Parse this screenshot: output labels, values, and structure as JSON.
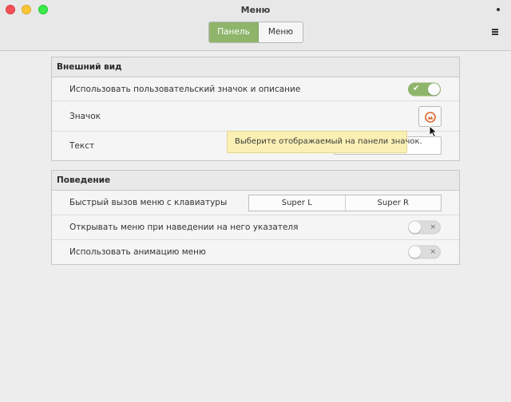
{
  "window": {
    "title": "Меню"
  },
  "switcher": {
    "panel_label": "Панель",
    "menu_label": "Меню",
    "active": "Панель"
  },
  "appearance": {
    "header": "Внешний вид",
    "custom_icon": {
      "label": "Использовать пользовательский значок и описание",
      "state": "on"
    },
    "icon": {
      "label": "Значок"
    },
    "text": {
      "label": "Текст",
      "value": ""
    }
  },
  "behavior": {
    "header": "Поведение",
    "hotkey": {
      "label": "Быстрый вызов меню с клавиатуры",
      "key1": "Super L",
      "key2": "Super R"
    },
    "hover_open": {
      "label": "Открывать меню при наведении на него указателя",
      "state": "off"
    },
    "animation": {
      "label": "Использовать анимацию меню",
      "state": "off"
    }
  },
  "tooltip": {
    "text": "Выберите отображаемый на панели значок."
  },
  "colors": {
    "accent": "#8fb56b",
    "tooltip_bg": "#fbf0b4",
    "icon_orange": "#e06a2c"
  },
  "icons": {
    "toggle_on": "check-icon",
    "toggle_off": "x-icon",
    "window_menu": "dot-icon",
    "app_menu": "hamburger-icon"
  }
}
